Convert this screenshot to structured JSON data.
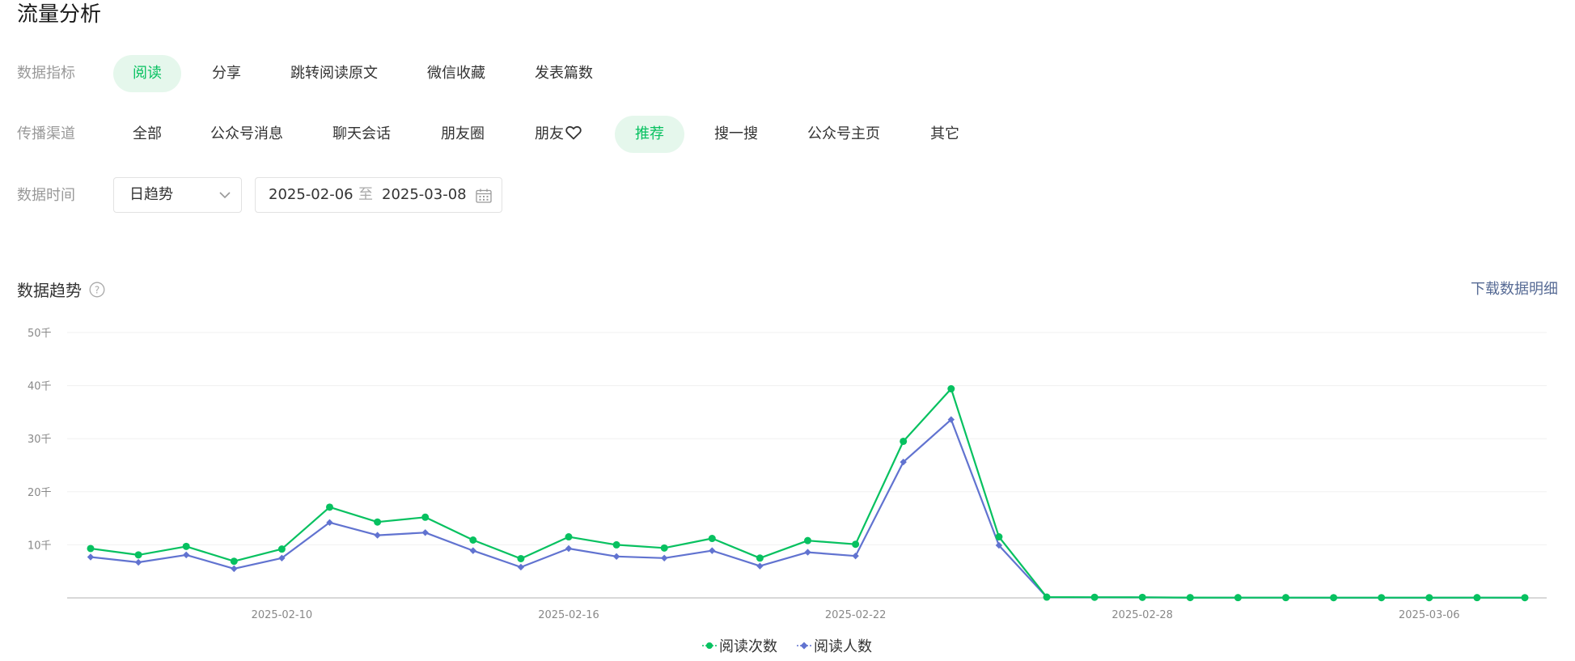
{
  "page": {
    "title": "流量分析"
  },
  "filters": {
    "metric_label": "数据指标",
    "metrics": [
      {
        "label": "阅读",
        "active": true
      },
      {
        "label": "分享",
        "active": false
      },
      {
        "label": "跳转阅读原文",
        "active": false
      },
      {
        "label": "微信收藏",
        "active": false
      },
      {
        "label": "发表篇数",
        "active": false
      }
    ],
    "channel_label": "传播渠道",
    "channels": [
      {
        "label": "全部",
        "active": false
      },
      {
        "label": "公众号消息",
        "active": false
      },
      {
        "label": "聊天会话",
        "active": false
      },
      {
        "label": "朋友圈",
        "active": false
      },
      {
        "label": "朋友",
        "active": false,
        "icon": "heart-icon"
      },
      {
        "label": "推荐",
        "active": true
      },
      {
        "label": "搜一搜",
        "active": false
      },
      {
        "label": "公众号主页",
        "active": false
      },
      {
        "label": "其它",
        "active": false
      }
    ],
    "time_label": "数据时间",
    "granularity": "日趋势",
    "date_start": "2025-02-06",
    "date_separator": "至",
    "date_end": "2025-03-08"
  },
  "trend": {
    "title": "数据趋势",
    "download_label": "下载数据明细"
  },
  "colors": {
    "accent": "#07c160",
    "accent_bg": "#e5f7ec",
    "series_reads": "#07c160",
    "series_readers": "#6173d0",
    "link": "#576b95"
  },
  "chart_data": {
    "type": "line",
    "x": [
      "2025-02-06",
      "2025-02-07",
      "2025-02-08",
      "2025-02-09",
      "2025-02-10",
      "2025-02-11",
      "2025-02-12",
      "2025-02-13",
      "2025-02-14",
      "2025-02-15",
      "2025-02-16",
      "2025-02-17",
      "2025-02-18",
      "2025-02-19",
      "2025-02-20",
      "2025-02-21",
      "2025-02-22",
      "2025-02-23",
      "2025-02-24",
      "2025-02-25",
      "2025-02-26",
      "2025-02-27",
      "2025-02-28",
      "2025-03-01",
      "2025-03-02",
      "2025-03-03",
      "2025-03-04",
      "2025-03-05",
      "2025-03-06",
      "2025-03-07",
      "2025-03-08"
    ],
    "x_tick_labels": [
      "2025-02-10",
      "2025-02-16",
      "2025-02-22",
      "2025-02-28",
      "2025-03-06"
    ],
    "y_tick_values": [
      10000,
      20000,
      30000,
      40000,
      50000
    ],
    "y_tick_labels": [
      "10千",
      "20千",
      "30千",
      "40千",
      "50千"
    ],
    "ylim": [
      0,
      50000
    ],
    "series": [
      {
        "name": "阅读次数",
        "marker": "circle",
        "values": [
          9300,
          8100,
          9700,
          6900,
          9200,
          17100,
          14300,
          15200,
          10900,
          7400,
          11500,
          10000,
          9400,
          11200,
          7500,
          10800,
          10100,
          29500,
          39400,
          11500,
          150,
          120,
          100,
          60,
          50,
          50,
          40,
          40,
          40,
          50,
          40
        ]
      },
      {
        "name": "阅读人数",
        "marker": "diamond",
        "values": [
          7700,
          6700,
          8100,
          5500,
          7500,
          14200,
          11800,
          12300,
          8900,
          5800,
          9300,
          7800,
          7500,
          8900,
          6000,
          8600,
          7900,
          25600,
          33600,
          9900,
          130,
          100,
          90,
          50,
          40,
          40,
          30,
          30,
          30,
          40,
          30
        ]
      }
    ],
    "grid": true,
    "legend_position": "bottom"
  }
}
